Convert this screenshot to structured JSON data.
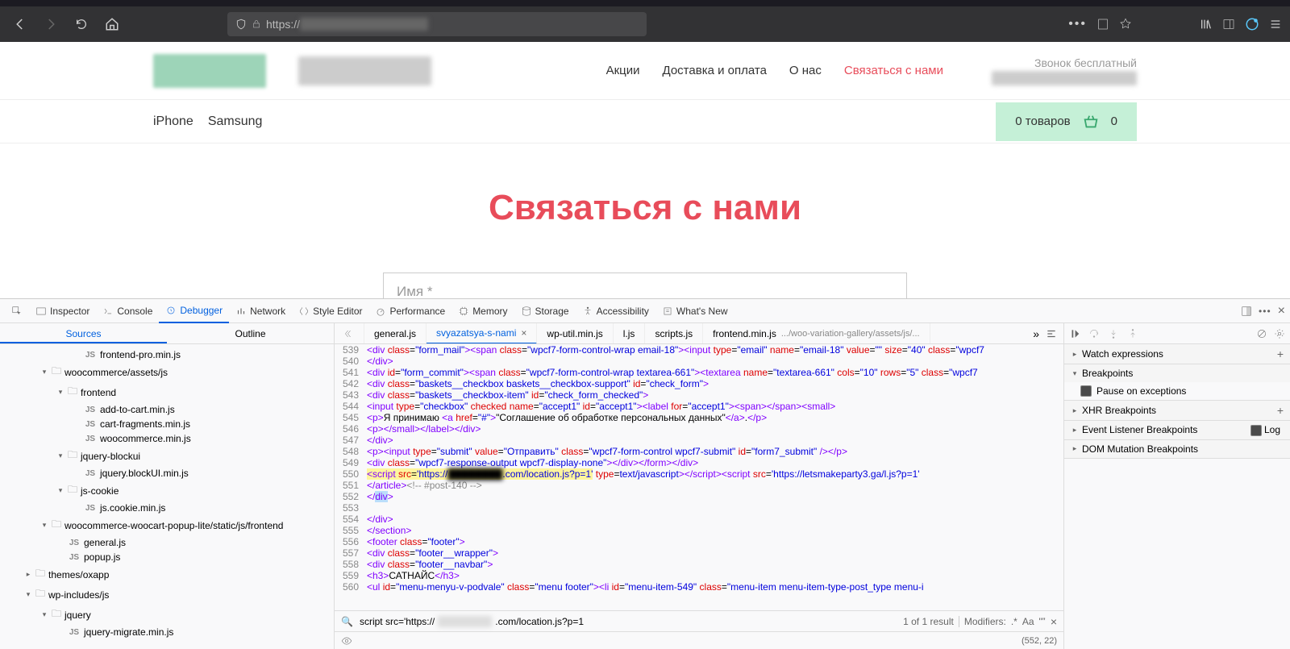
{
  "browser": {
    "url_prefix": "https://",
    "url_hidden": "████████████████",
    "icons": {
      "back": "back",
      "forward": "forward",
      "reload": "reload",
      "home": "home",
      "shield": "shield",
      "lock": "lock",
      "dots": "dots",
      "reader": "reader",
      "star": "star",
      "library": "library",
      "sidebar": "sidebar",
      "account": "account",
      "menu": "menu"
    }
  },
  "site": {
    "nav": [
      "Акции",
      "Доставка и оплата",
      "О нас",
      "Связаться с нами"
    ],
    "active_nav_index": 3,
    "phone_label": "Звонок бесплатный",
    "sec_links": [
      "iPhone",
      "Samsung"
    ],
    "cart_text": "0 товаров",
    "cart_count": "0",
    "page_title": "Связаться с нами",
    "name_placeholder": "Имя *"
  },
  "devtools": {
    "tabs": [
      "Inspector",
      "Console",
      "Debugger",
      "Network",
      "Style Editor",
      "Performance",
      "Memory",
      "Storage",
      "Accessibility",
      "What's New"
    ],
    "active_tab_index": 2,
    "sources_tabs": [
      "Sources",
      "Outline"
    ],
    "active_sources_tab": 0,
    "tree": [
      {
        "depth": 4,
        "type": "js",
        "label": "frontend-pro.min.js"
      },
      {
        "depth": 2,
        "type": "folder",
        "open": true,
        "label": "woocommerce/assets/js"
      },
      {
        "depth": 3,
        "type": "folder",
        "open": true,
        "label": "frontend"
      },
      {
        "depth": 4,
        "type": "js",
        "label": "add-to-cart.min.js"
      },
      {
        "depth": 4,
        "type": "js",
        "label": "cart-fragments.min.js"
      },
      {
        "depth": 4,
        "type": "js",
        "label": "woocommerce.min.js"
      },
      {
        "depth": 3,
        "type": "folder",
        "open": true,
        "label": "jquery-blockui"
      },
      {
        "depth": 4,
        "type": "js",
        "label": "jquery.blockUI.min.js"
      },
      {
        "depth": 3,
        "type": "folder",
        "open": true,
        "label": "js-cookie"
      },
      {
        "depth": 4,
        "type": "js",
        "label": "js.cookie.min.js"
      },
      {
        "depth": 2,
        "type": "folder",
        "open": true,
        "label": "woocommerce-woocart-popup-lite/static/js/frontend"
      },
      {
        "depth": 3,
        "type": "js",
        "label": "general.js"
      },
      {
        "depth": 3,
        "type": "js",
        "label": "popup.js"
      },
      {
        "depth": 1,
        "type": "folder",
        "open": false,
        "label": "themes/oxapp"
      },
      {
        "depth": 1,
        "type": "folder",
        "open": true,
        "label": "wp-includes/js"
      },
      {
        "depth": 2,
        "type": "folder",
        "open": true,
        "label": "jquery"
      },
      {
        "depth": 3,
        "type": "js",
        "label": "jquery-migrate.min.js"
      }
    ],
    "file_tabs": [
      {
        "label": "general.js"
      },
      {
        "label": "svyazatsya-s-nami",
        "active": true,
        "closable": true
      },
      {
        "label": "wp-util.min.js"
      },
      {
        "label": "l.js"
      },
      {
        "label": "scripts.js"
      },
      {
        "label": "frontend.min.js",
        "extra": ".../woo-variation-gallery/assets/js/..."
      }
    ],
    "code_start_line": 539,
    "search": {
      "query_prefix": "script src='https://",
      "query_hidden": "██████",
      "query_suffix": ".com/location.js?p=1",
      "result": "1 of 1 result",
      "modifiers": "Modifiers:"
    },
    "footer_coords": "(552, 22)",
    "right_panel": {
      "sections": {
        "watch": "Watch expressions",
        "breakpoints": "Breakpoints",
        "pause": "Pause on exceptions",
        "xhr": "XHR Breakpoints",
        "event": "Event Listener Breakpoints",
        "dom": "DOM Mutation Breakpoints",
        "log": "Log"
      }
    }
  }
}
